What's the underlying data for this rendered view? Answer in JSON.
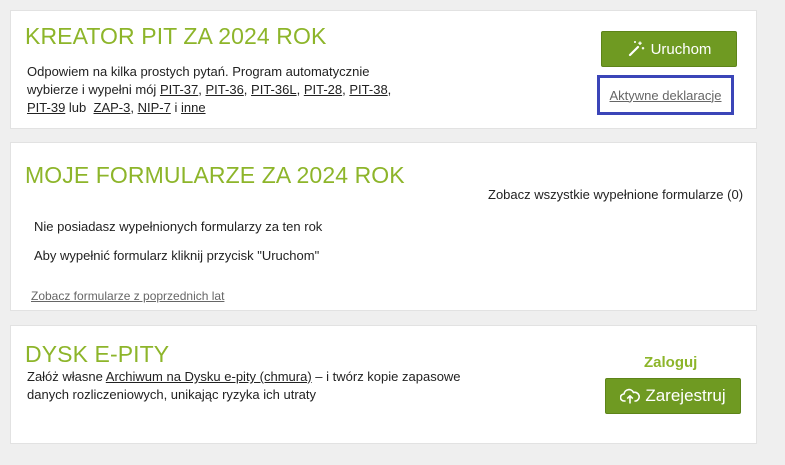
{
  "kreator": {
    "title": "KREATOR PIT ZA 2024 ROK",
    "line1": "Odpowiem na kilka prostych pytań. Program automatycznie",
    "line2_prefix": "wybierze i wypełni mój",
    "forms": [
      "PIT-37",
      "PIT-36",
      "PIT-36L",
      "PIT-28",
      "PIT-38",
      "PIT-39",
      "ZAP-3",
      "NIP-7",
      "inne"
    ],
    "sep_comma": ",",
    "word_lub": "lub",
    "word_i": "i",
    "run_button": "Uruchom",
    "active_link": "Aktywne deklaracje",
    "wand_icon": "magic-wand-icon"
  },
  "moje": {
    "title": "MOJE FORMULARZE ZA 2024 ROK",
    "see_all": "Zobacz wszystkie wypełnione formularze (0)",
    "none_msg": "Nie posiadasz wypełnionych formularzy za ten rok",
    "hint_msg": "Aby wypełnić formularz kliknij przycisk \"Uruchom\"",
    "prev_link": "Zobacz formularze z poprzednich lat"
  },
  "dysk": {
    "title": "DYSK E-PITY",
    "text_prefix": "Załóż własne",
    "archive_link": "Archiwum na Dysku e-pity (chmura)",
    "text_suffix": "– i twórz kopie zapasowe",
    "line2": "danych rozliczeniowych, unikając ryzyka ich utraty",
    "login": "Zaloguj",
    "register_button": "Zarejestruj",
    "cloud_icon": "cloud-upload-icon"
  },
  "colors": {
    "accent": "#8db52a",
    "button": "#6f9a22",
    "highlight": "#3b45b8"
  }
}
